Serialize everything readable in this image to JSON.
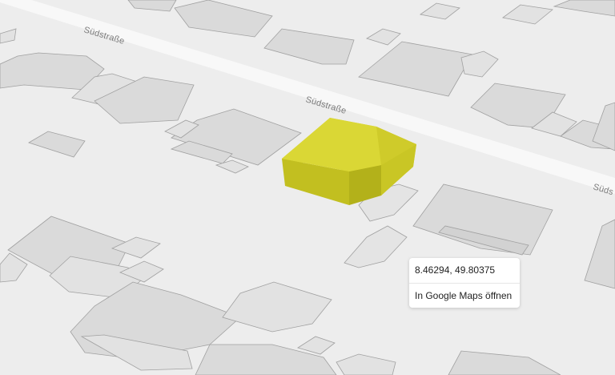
{
  "map": {
    "streets": [
      {
        "name": "Südstraße"
      },
      {
        "name": "Südstraße"
      },
      {
        "name": "Süds"
      }
    ],
    "colors": {
      "ground": "#ededed",
      "road": "#f8f8f8",
      "building_top": "#d9d9d9",
      "building_side": "#cfcfcf",
      "building_outline": "#9a9a9a",
      "selected_top": "#d6d431",
      "selected_side": "#c2bf21"
    }
  },
  "popup": {
    "coordinates": "8.46294, 49.80375",
    "google_maps_link": "In Google Maps öffnen"
  }
}
